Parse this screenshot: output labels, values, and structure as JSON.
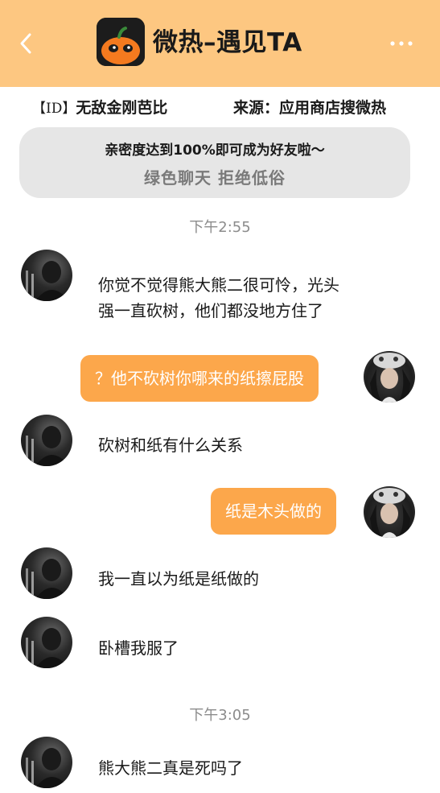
{
  "header": {
    "title": "微热–遇见TA",
    "back_icon": "chevron-left-icon",
    "more_icon": "more-dots-icon",
    "logo_icon": "pumpkin-logo-icon",
    "background_color": "#fdc781"
  },
  "info_bar": {
    "id_tag": "【ID】",
    "username": "无敌金刚芭比",
    "source": "来源：应用商店搜微热"
  },
  "notice": {
    "line1": "亲密度达到100%即可成为好友啦～",
    "line2": "绿色聊天  拒绝低俗"
  },
  "chat": {
    "outgoing_bubble_color": "#fca74b",
    "timestamps": [
      "下午2:55",
      "下午3:05"
    ],
    "messages": [
      {
        "side": "left",
        "text_line1": "你觉不觉得熊大熊二很可怜，光头",
        "text_line2": "强一直砍树，他们都没地方住了"
      },
      {
        "side": "right",
        "text": "？他不砍树你哪来的纸擦屁股"
      },
      {
        "side": "left",
        "text": "砍树和纸有什么关系"
      },
      {
        "side": "right",
        "text": "纸是木头做的"
      },
      {
        "side": "left",
        "text": "我一直以为纸是纸做的"
      },
      {
        "side": "left",
        "text": "卧槽我服了"
      },
      {
        "side": "left",
        "text": "熊大熊二真是死吗了"
      }
    ]
  }
}
